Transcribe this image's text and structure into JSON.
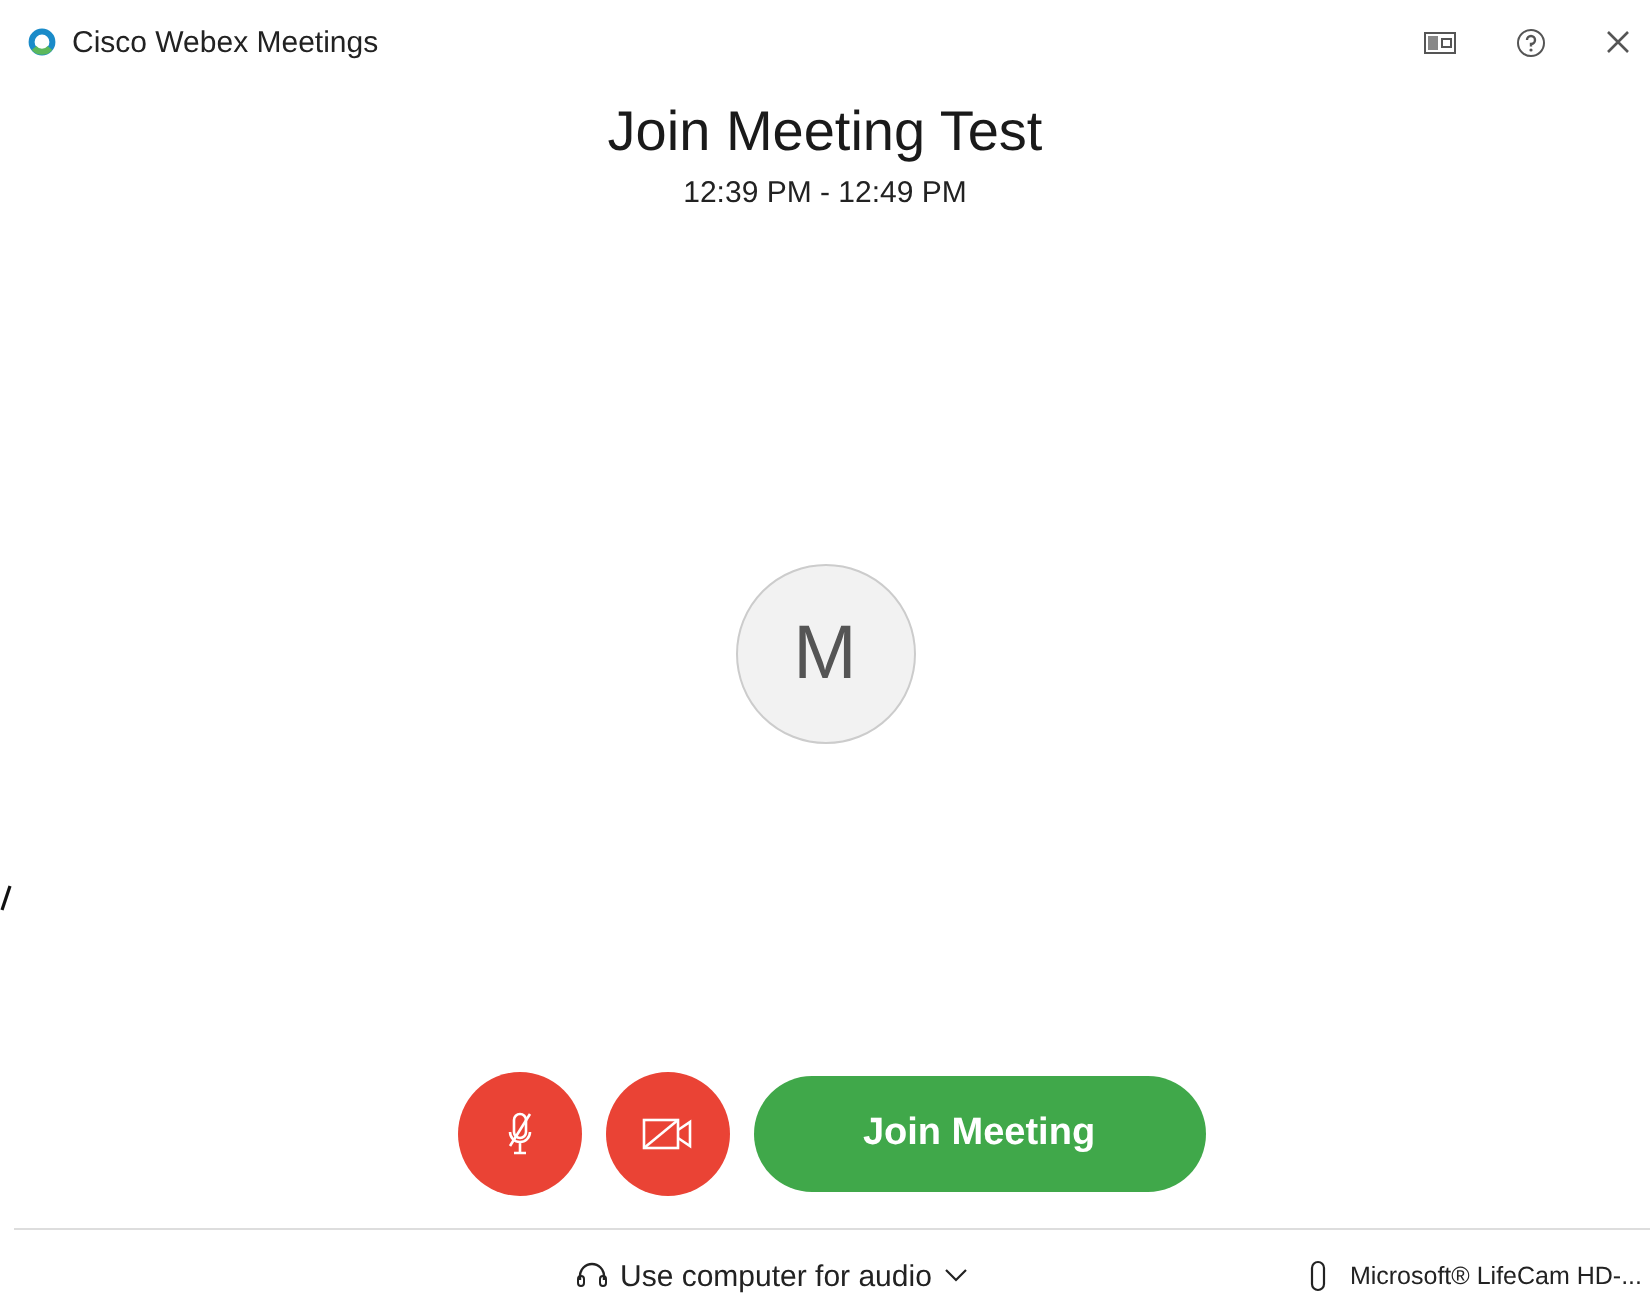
{
  "window": {
    "title": "Cisco Webex Meetings"
  },
  "meeting": {
    "title": "Join Meeting Test",
    "time": "12:39 PM - 12:49 PM",
    "avatar_initial": "M"
  },
  "controls": [
    {
      "kind": "mic",
      "muted": true
    },
    {
      "kind": "camera",
      "muted": true
    }
  ],
  "join_button": "Join Meeting",
  "footer": {
    "audio": "Use computer for audio",
    "camera": "Microsoft® LifeCam HD-..."
  }
}
